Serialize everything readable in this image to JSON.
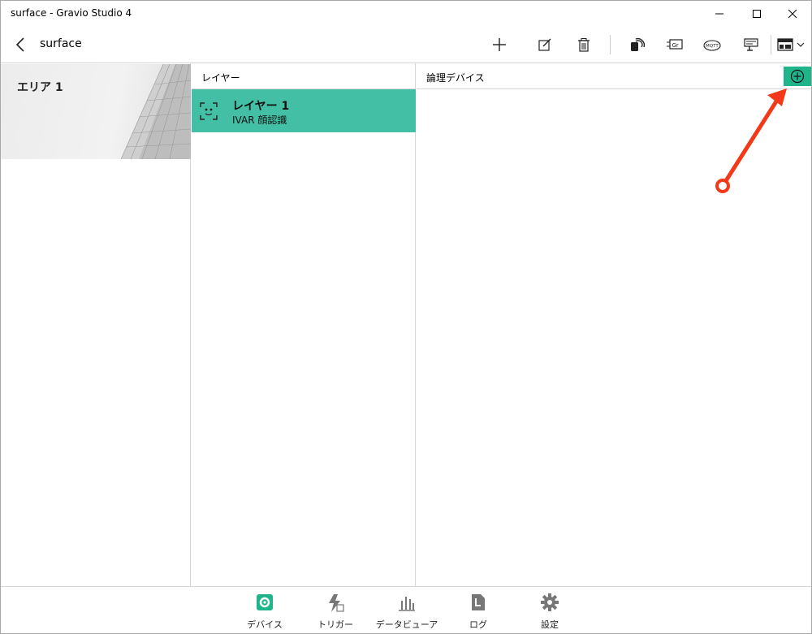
{
  "window": {
    "title": "surface - Gravio Studio 4"
  },
  "header": {
    "title": "surface"
  },
  "areas": [
    {
      "label": "エリア 1"
    }
  ],
  "layers": {
    "header": "レイヤー",
    "items": [
      {
        "name": "レイヤー 1",
        "subtitle": "IVAR 顔認識"
      }
    ]
  },
  "devices": {
    "header": "論理デバイス"
  },
  "colors": {
    "accent": "#42bfa4",
    "add_button": "#1fb48a",
    "annotation": "#f23a1a"
  },
  "toolbar_icons": [
    "add-icon",
    "edit-icon",
    "delete-icon",
    "nfc-icon",
    "camera-gr-icon",
    "mqtt-icon",
    "display-icon",
    "layout-icon"
  ],
  "nav": [
    {
      "label": "デバイス",
      "icon": "gear-icon",
      "active": true
    },
    {
      "label": "トリガー",
      "icon": "trigger-icon",
      "active": false
    },
    {
      "label": "データビューア",
      "icon": "bar-chart-icon",
      "active": false
    },
    {
      "label": "ログ",
      "icon": "log-icon",
      "active": false
    },
    {
      "label": "設定",
      "icon": "settings-icon",
      "active": false
    }
  ]
}
